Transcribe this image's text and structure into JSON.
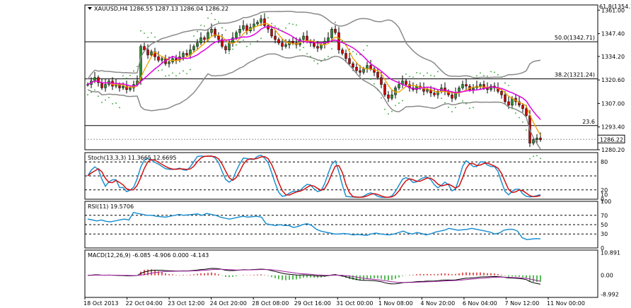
{
  "chart_data": {
    "type": "candlestick",
    "symbol_header": "XAUUSD,H4  1286.55 1287.13 1286.04 1286.22",
    "top_right_label": "61.8(1354.12)",
    "price_panel": {
      "ylim": [
        1280.2,
        1364.0
      ],
      "y_ticks": [
        "1361.00",
        "1347.40",
        "1334.20",
        "1320.60",
        "1307.00",
        "1293.40",
        "1280.20"
      ],
      "current_price_label": "1286.22",
      "fib_levels": [
        {
          "label": "50.0(1342.71)",
          "value": 1342.71
        },
        {
          "label": "38.2(1321.24)",
          "value": 1321.24
        },
        {
          "label": "23.6",
          "value": 1294.2
        }
      ],
      "candles_close": [
        1318,
        1320,
        1322,
        1319,
        1316,
        1318,
        1320,
        1317,
        1318,
        1316,
        1317,
        1315,
        1316,
        1318,
        1320,
        1340,
        1338,
        1335,
        1337,
        1334,
        1332,
        1333,
        1330,
        1331,
        1333,
        1332,
        1334,
        1336,
        1335,
        1338,
        1340,
        1342,
        1345,
        1344,
        1348,
        1350,
        1346,
        1344,
        1340,
        1338,
        1342,
        1345,
        1348,
        1350,
        1352,
        1349,
        1351,
        1353,
        1354,
        1356,
        1352,
        1350,
        1346,
        1344,
        1342,
        1340,
        1341,
        1343,
        1342,
        1341,
        1344,
        1346,
        1343,
        1342,
        1340,
        1339,
        1341,
        1343,
        1345,
        1350,
        1348,
        1338,
        1336,
        1333,
        1330,
        1328,
        1326,
        1325,
        1327,
        1329,
        1327,
        1325,
        1322,
        1318,
        1312,
        1310,
        1312,
        1316,
        1318,
        1320,
        1318,
        1316,
        1315,
        1317,
        1316,
        1314,
        1315,
        1313,
        1312,
        1314,
        1316,
        1314,
        1312,
        1310,
        1313,
        1316,
        1318,
        1317,
        1315,
        1316,
        1317,
        1318,
        1316,
        1315,
        1317,
        1316,
        1314,
        1312,
        1308,
        1306,
        1310,
        1308,
        1306,
        1304,
        1300,
        1284,
        1286,
        1287,
        1286
      ],
      "bollinger_upper_desc": "grey upper band",
      "sar_desc": "green dotted parabolic SAR"
    },
    "stoch_panel": {
      "label": "Stoch(13,3,3) 11.3665 12.6695",
      "levels": [
        "80",
        "20",
        "10",
        "0"
      ],
      "ylim": [
        0,
        100
      ]
    },
    "rsi_panel": {
      "label": "RSI(11) 19.5706",
      "levels": [
        "100",
        "70",
        "50",
        "30",
        "0"
      ],
      "ylim": [
        0,
        100
      ],
      "values": [
        62,
        60,
        58,
        60,
        57,
        56,
        58,
        60,
        62,
        60,
        76,
        74,
        72,
        70,
        70,
        68,
        67,
        66,
        68,
        70,
        72,
        70,
        71,
        72,
        73,
        70,
        74,
        72,
        70,
        66,
        64,
        62,
        64,
        66,
        68,
        66,
        67,
        68,
        66,
        52,
        50,
        48,
        50,
        48,
        48,
        44,
        46,
        50,
        52,
        48,
        40,
        36,
        34,
        32,
        30,
        30,
        31,
        30,
        28,
        29,
        28,
        27,
        30,
        32,
        30,
        29,
        28,
        30,
        33,
        36,
        32,
        30,
        33,
        31,
        28,
        30,
        34,
        36,
        38,
        42,
        40,
        38,
        39,
        40,
        42,
        40,
        38,
        36,
        34,
        30,
        32,
        38,
        40,
        40,
        36,
        22,
        18,
        19,
        20,
        19.57
      ]
    },
    "macd_panel": {
      "label": "MACD(12,26,9) -6.085 -4.906 0.000 -4.143",
      "y_ticks": [
        "10.891",
        "0.00",
        "-8.992"
      ],
      "ylim": [
        -10.5,
        12
      ]
    },
    "x_tick_labels": [
      "18 Oct 2013",
      "22 Oct 04:00",
      "23 Oct 12:00",
      "24 Oct 20:00",
      "28 Oct 08:00",
      "29 Oct 16:00",
      "31 Oct 00:00",
      "1 Nov 08:00",
      "4 Nov 20:00",
      "6 Nov 04:00",
      "7 Nov 12:00",
      "11 Nov 00:00"
    ]
  }
}
